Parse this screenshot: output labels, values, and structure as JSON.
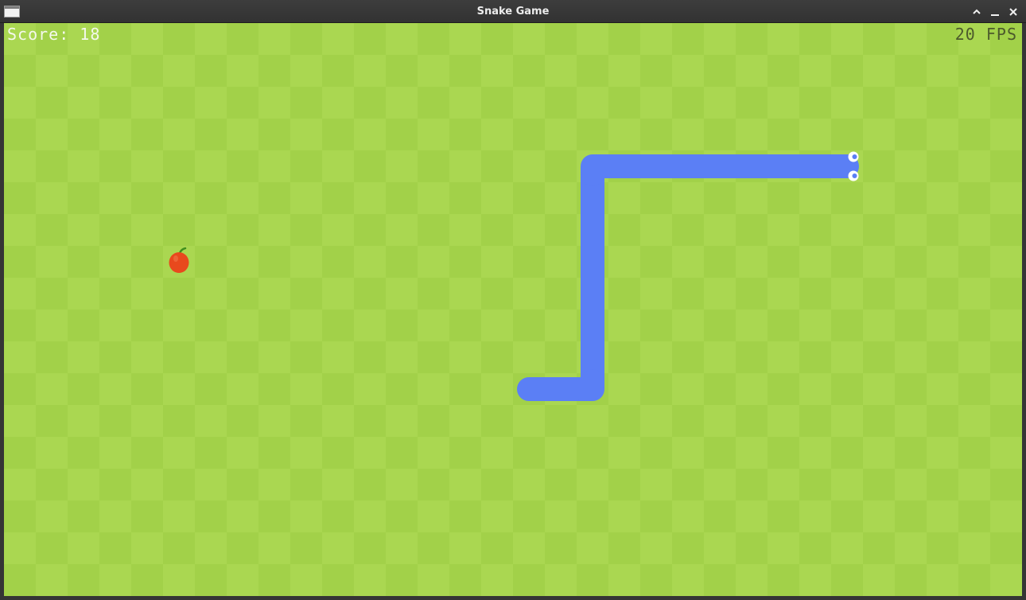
{
  "window": {
    "title": "Snake Game"
  },
  "hud": {
    "score_text": "Score: 18",
    "fps_text": "20 FPS"
  },
  "board": {
    "cols": 32,
    "rows": 18,
    "light_color": "#aad751",
    "dark_color": "#a2d149"
  },
  "snake": {
    "color": "#5b7ff5",
    "direction": "right",
    "cells": [
      [
        16,
        11
      ],
      [
        17,
        11
      ],
      [
        18,
        11
      ],
      [
        18,
        10
      ],
      [
        18,
        9
      ],
      [
        18,
        8
      ],
      [
        18,
        7
      ],
      [
        18,
        6
      ],
      [
        18,
        5
      ],
      [
        18,
        4
      ],
      [
        19,
        4
      ],
      [
        20,
        4
      ],
      [
        21,
        4
      ],
      [
        22,
        4
      ],
      [
        23,
        4
      ],
      [
        24,
        4
      ],
      [
        25,
        4
      ],
      [
        26,
        4
      ]
    ]
  },
  "food": {
    "type": "apple",
    "cell": [
      5,
      7
    ],
    "color": "#e8491d",
    "stem_color": "#3f8f1d"
  }
}
